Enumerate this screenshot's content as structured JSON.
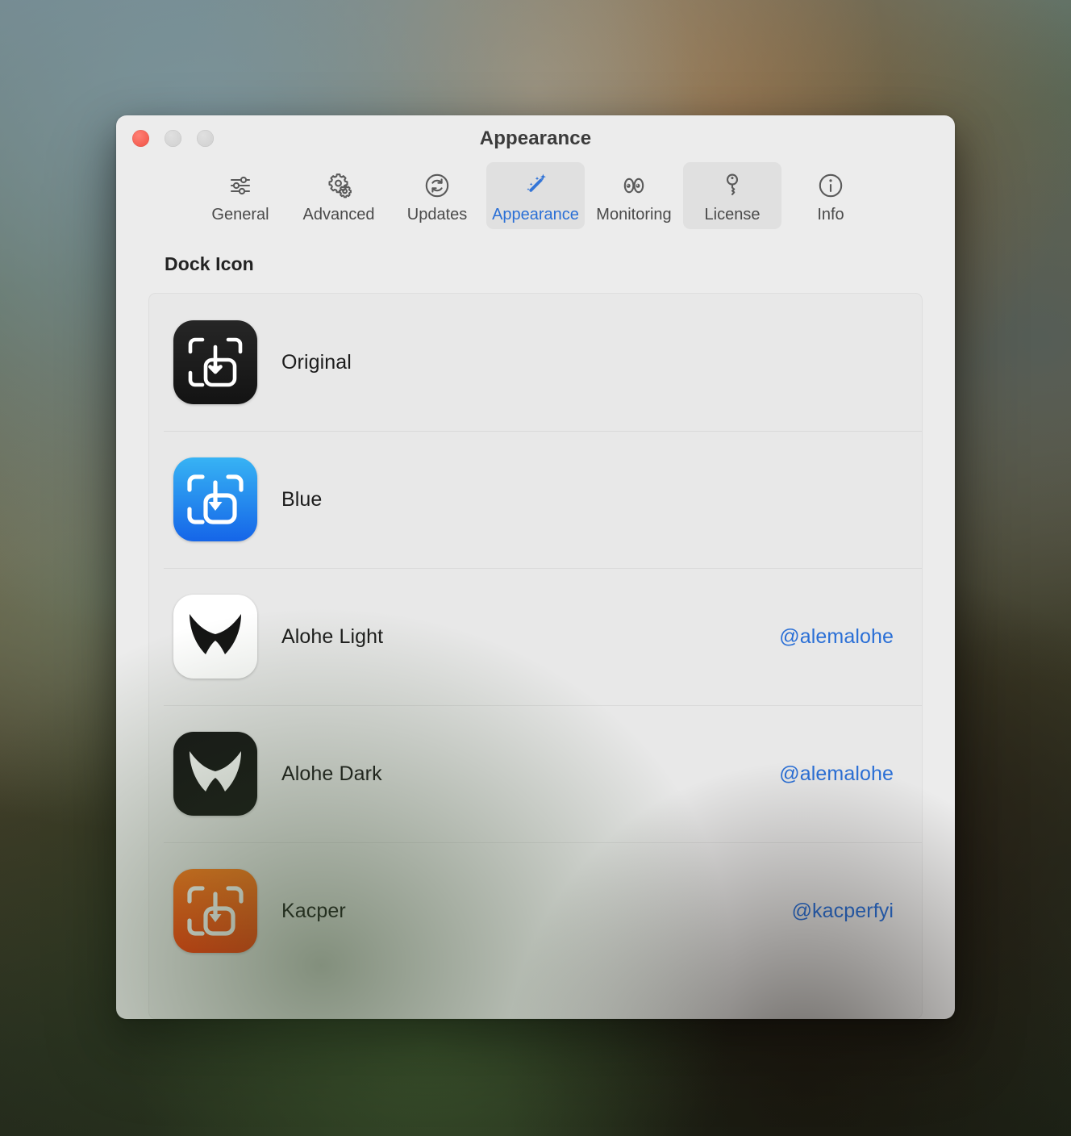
{
  "window": {
    "title": "Appearance",
    "traffic_lights": [
      {
        "name": "close",
        "color": "#f05043"
      },
      {
        "name": "minimize",
        "color": "#cfcfcf"
      },
      {
        "name": "maximize",
        "color": "#cfcfcf"
      }
    ]
  },
  "toolbar": {
    "tabs": [
      {
        "label": "General",
        "icon": "sliders-icon",
        "state": "normal"
      },
      {
        "label": "Advanced",
        "icon": "gears-icon",
        "state": "normal"
      },
      {
        "label": "Updates",
        "icon": "refresh-icon",
        "state": "normal"
      },
      {
        "label": "Appearance",
        "icon": "magic-wand-icon",
        "state": "selected"
      },
      {
        "label": "Monitoring",
        "icon": "eyes-icon",
        "state": "normal"
      },
      {
        "label": "License",
        "icon": "key-icon",
        "state": "hover"
      },
      {
        "label": "Info",
        "icon": "info-circle-icon",
        "state": "normal"
      }
    ],
    "accent_color": "#2a6fd6"
  },
  "main": {
    "section_title": "Dock Icon",
    "icon_options": [
      {
        "label": "Original",
        "credit": "",
        "icon": "app-icon-original",
        "style": "dark"
      },
      {
        "label": "Blue",
        "credit": "",
        "icon": "app-icon-blue",
        "style": "blue"
      },
      {
        "label": "Alohe Light",
        "credit": "@alemalohe",
        "icon": "app-icon-alohe-light",
        "style": "white"
      },
      {
        "label": "Alohe Dark",
        "credit": "@alemalohe",
        "icon": "app-icon-alohe-dark",
        "style": "black"
      },
      {
        "label": "Kacper",
        "credit": "@kacperfyi",
        "icon": "app-icon-kacper",
        "style": "orange"
      }
    ]
  }
}
